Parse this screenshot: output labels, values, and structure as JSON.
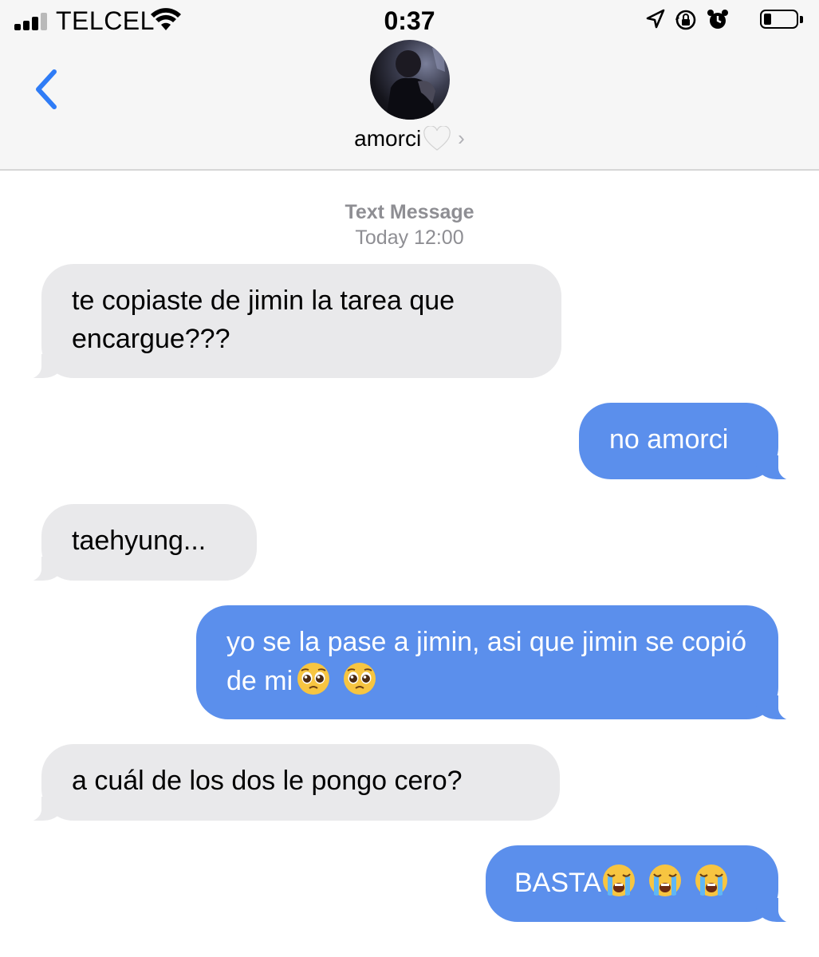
{
  "status_bar": {
    "carrier": "TELCEL",
    "time": "0:37",
    "icons": [
      "signal-icon",
      "wifi-icon",
      "location-icon",
      "rotation-lock-icon",
      "alarm-icon",
      "battery-icon"
    ]
  },
  "header": {
    "back_icon": "chevron-left-icon",
    "contact_name": "amorci",
    "contact_emoji": "white-heart-icon",
    "accent_color": "#2f7cf6"
  },
  "conversation": {
    "meta_label": "Text Message",
    "meta_time": "Today 12:00",
    "messages": [
      {
        "direction": "incoming",
        "text": "te copiaste de jimin la tarea que encargue???"
      },
      {
        "direction": "outgoing",
        "text": "no amorci"
      },
      {
        "direction": "incoming",
        "text": "taehyung..."
      },
      {
        "direction": "outgoing",
        "text": "yo se la pase a jimin, asi que jimin se copió de mi",
        "emojis": [
          "pleading-face-icon",
          "pleading-face-icon"
        ]
      },
      {
        "direction": "incoming",
        "text": "a cuál de los dos le pongo cero?"
      },
      {
        "direction": "outgoing",
        "text": "BASTA",
        "emojis": [
          "crying-face-icon",
          "crying-face-icon",
          "crying-face-icon"
        ]
      }
    ],
    "colors": {
      "incoming_bubble": "#e9e9eb",
      "outgoing_bubble": "#5b8fec",
      "meta_text": "#8e8e93"
    }
  }
}
